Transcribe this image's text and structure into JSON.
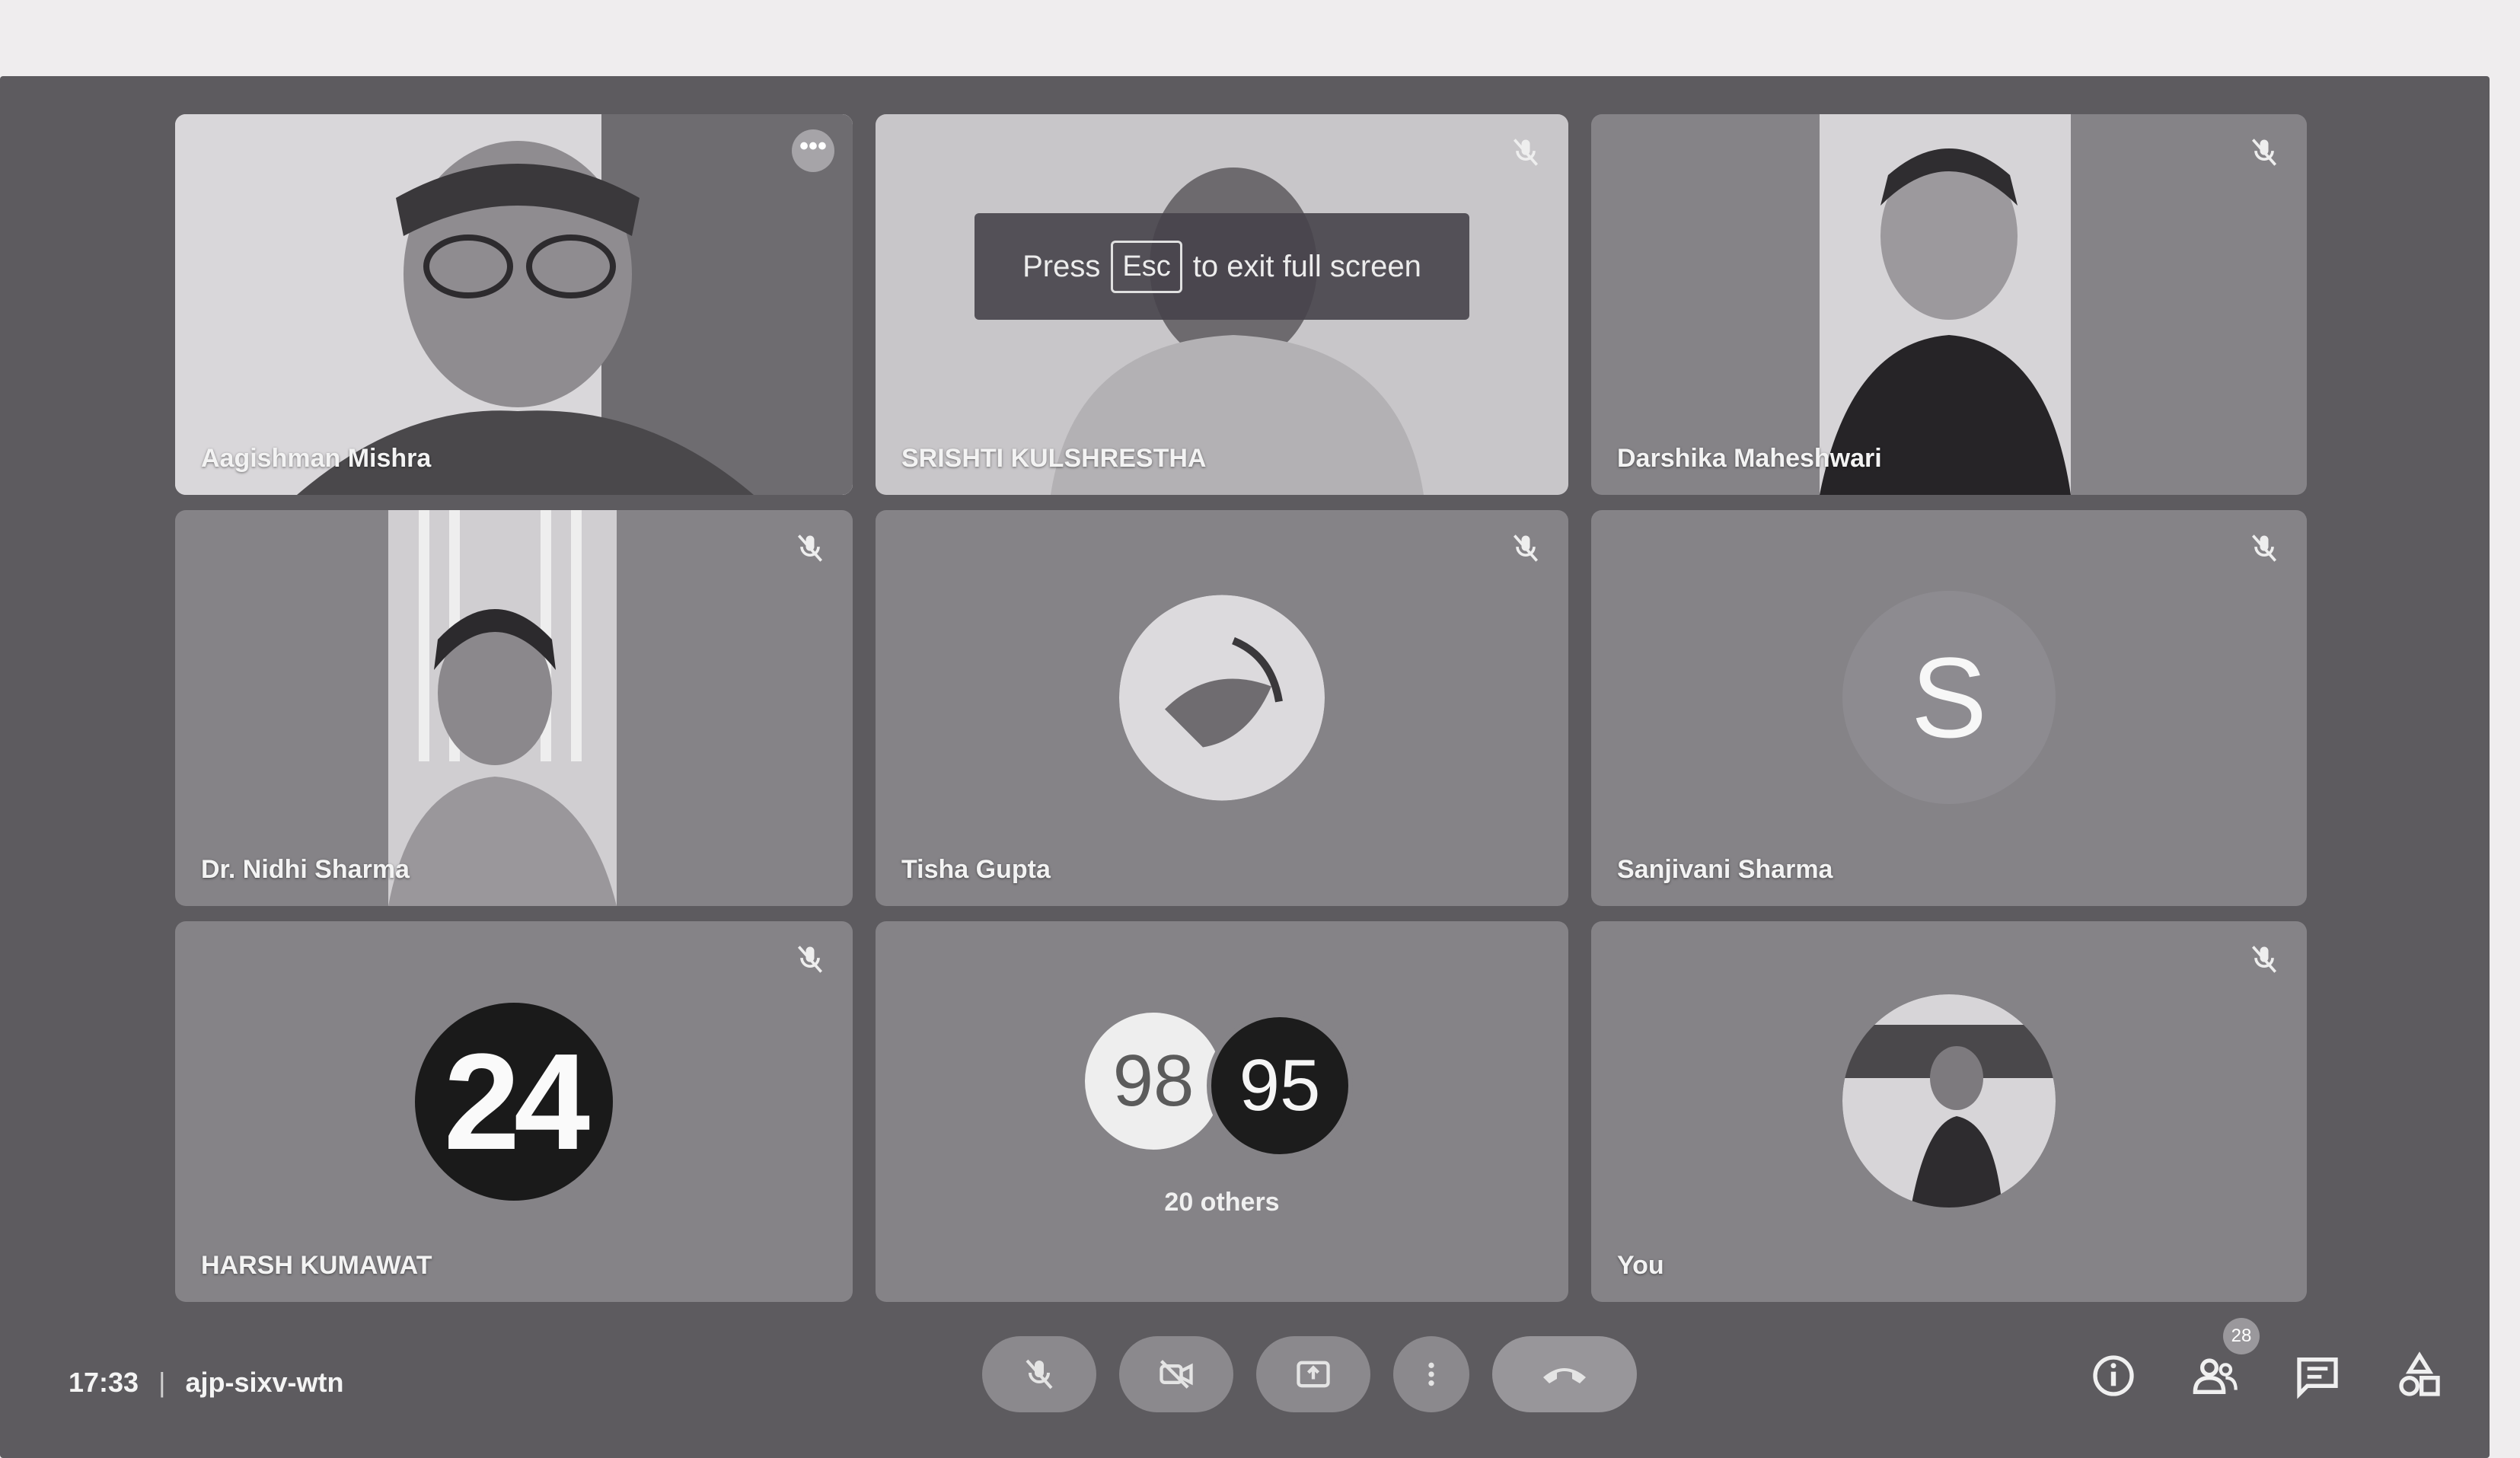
{
  "banner": {
    "press": "Press",
    "key": "Esc",
    "rest": "to exit full screen"
  },
  "tiles": [
    {
      "name": "Aagishman Mishra",
      "kind": "video"
    },
    {
      "name": "SRISHTI KULSHRESTHA",
      "kind": "video"
    },
    {
      "name": "Darshika Maheshwari",
      "kind": "video"
    },
    {
      "name": "Dr. Nidhi Sharma",
      "kind": "video"
    },
    {
      "name": "Tisha Gupta",
      "kind": "photo-avatar"
    },
    {
      "name": "Sanjivani Sharma",
      "kind": "letter-avatar",
      "letter": "S"
    },
    {
      "name": "HARSH KUMAWAT",
      "kind": "badge-avatar",
      "badge": "24"
    },
    {
      "kind": "others",
      "avatar_a": "98",
      "avatar_b": "95",
      "label": "20 others"
    },
    {
      "name": "You",
      "kind": "photo-avatar"
    }
  ],
  "footer": {
    "time": "17:33",
    "separator": "|",
    "meeting_code": "ajp-sixv-wtn",
    "participants_count": "28"
  },
  "controls": [
    "mic-off",
    "camera-off",
    "present-screen",
    "more-options",
    "leave-call"
  ],
  "colors": {
    "stage": "#5d5b5f",
    "tile": "#858387",
    "control": "#8b898d"
  }
}
